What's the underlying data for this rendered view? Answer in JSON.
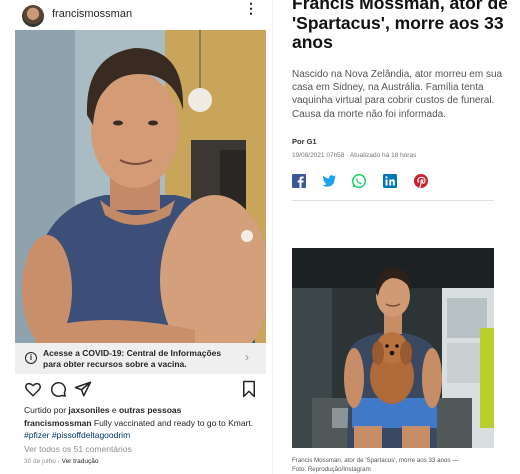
{
  "instagram": {
    "username": "francismossman",
    "more_glyph": "⋮",
    "covid_banner": {
      "icon_glyph": "i",
      "line1": "Acesse a COVID-19: Central de Informações",
      "line2": "para obter recursos sobre a vacina.",
      "chevron": "›"
    },
    "actions": [
      "heart-icon",
      "comment-icon",
      "share-icon",
      "bookmark-icon"
    ],
    "liked_by_prefix": "Curtido por ",
    "liked_by_user": "jaxsoniles",
    "liked_by_join": " e ",
    "liked_by_others": "outras pessoas",
    "caption_user": "francismossman",
    "caption_text": " Fully vaccinated and ready to go to Kmart.",
    "hashtags": "#pfizer #pissoffdeltagoodrim",
    "comments_link": "Ver todos os 51 comentários",
    "date": "30 de julho",
    "translate_link": "· Ver tradução"
  },
  "article": {
    "headline": "Francis Mossman, ator de 'Spartacus', morre aos 33 anos",
    "lead": "Nascido na Nova Zelândia, ator morreu em sua casa em Sidney, na Austrália. Família tenta vaquinha virtual para cobrir custos de funeral. Causa da morte não foi informada.",
    "source": "Por G1",
    "datetime": "19/08/2021 07h58 · Atualizado há 18 horas",
    "share_buttons": [
      {
        "icon": "facebook-icon",
        "color": "#3b5998"
      },
      {
        "icon": "twitter-icon",
        "color": "#1da1f2"
      },
      {
        "icon": "whatsapp-icon",
        "color": "#25d366"
      },
      {
        "icon": "linkedin-icon",
        "color": "#0077b5"
      },
      {
        "icon": "pinterest-icon",
        "color": "#cb2027"
      }
    ],
    "photo_caption_line1": "Francis Mossman, ator de 'Spartacus', morre aos 33 anos —",
    "photo_caption_line2": "Foto: Reprodução/Instagram"
  },
  "colors": {
    "instagram_link": "#00376b",
    "muted": "#8e8e8e",
    "banner_bg": "#efefef"
  }
}
